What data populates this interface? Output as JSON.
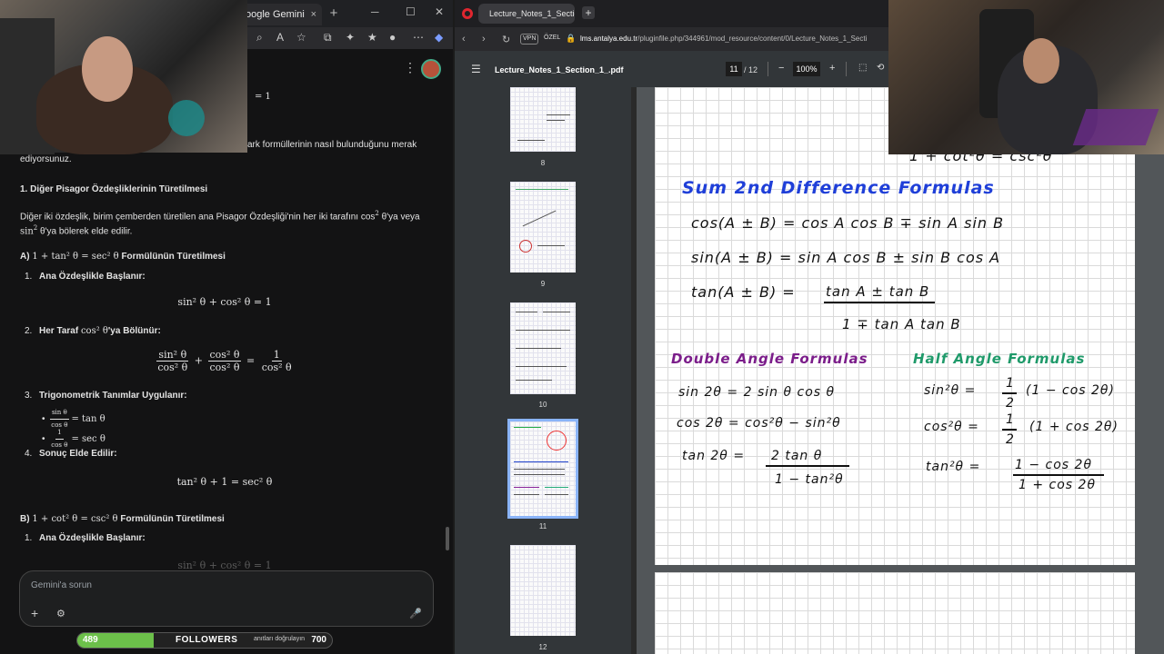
{
  "gemini": {
    "tab_title": "oogle Gemini",
    "close": "×",
    "new_tab": "+",
    "win_min": "─",
    "win_max": "☐",
    "win_close": "✕",
    "menu_icon": "⋮",
    "frag_top_math": "= 1",
    "frag_line1": "ark formüllerinin nasıl bulunduğunu merak",
    "frag_line2": "ediyorsunuz.",
    "section1_title": "1. Diğer Pisagor Özdeşliklerinin Türetilmesi",
    "intro_line1_a": "Diğer iki özdeşlik, birim çemberden türetilen ana Pisagor Özdeşliği'nin her iki tarafını cos",
    "intro_line1_b": "θ'ya veya",
    "intro_line2_a": "sin",
    "intro_line2_b": "θ'ya bölerek elde edilir.",
    "partA_prefix": "A)",
    "partA_math": "1 + tan² θ = sec² θ",
    "partA_suffix": "Formülünün Türetilmesi",
    "step1_num": "1.",
    "step1_label": "Ana Özdeşlikle Başlanır:",
    "eq1": "sin² θ + cos² θ = 1",
    "step2_num": "2.",
    "step2_label_a": "Her Taraf",
    "step2_label_math": "cos² θ",
    "step2_label_b": "'ya Bölünür:",
    "eq2_n1": "sin² θ",
    "eq2_d1": "cos² θ",
    "eq2_plus": "+",
    "eq2_n2": "cos² θ",
    "eq2_d2": "cos² θ",
    "eq2_eq": "=",
    "eq2_n3": "1",
    "eq2_d3": "cos² θ",
    "step3_num": "3.",
    "step3_label": "Trigonometrik Tanımlar Uygulanır:",
    "bullet1_n": "sin θ",
    "bullet1_d": "cos θ",
    "bullet1_r": "= tan θ",
    "bullet2_n": "1",
    "bullet2_d": "cos θ",
    "bullet2_r": "= sec θ",
    "step4_num": "4.",
    "step4_label": "Sonuç Elde Edilir:",
    "eq4": "tan² θ + 1 = sec² θ",
    "partB_prefix": "B)",
    "partB_math": "1 + cot² θ = csc² θ",
    "partB_suffix": "Formülünün Türetilmesi",
    "stepB1_num": "1.",
    "stepB1_label": "Ana Özdeşlikle Başlanır:",
    "eqB1_faded": "sin² θ + cos² θ = 1",
    "input_placeholder": "Gemini'a sorun",
    "input_plus": "+",
    "input_tools": "⚙",
    "input_mic": "🎤"
  },
  "followers_widget": {
    "current": "489",
    "label": "FOLLOWERS",
    "hidden_text": "anıtları doğrulayın",
    "goal": "700",
    "progress_fraction": 0.3,
    "fill_color": "#6cc04a"
  },
  "opera": {
    "tab_title": "Lecture_Notes_1_Section_",
    "new_tab": "+",
    "vpn": "VPN",
    "private": "ÖZEL",
    "url_host": "lms.antalya.edu.tr",
    "url_path": "/pluginfile.php/344961/mod_resource/content/0/Lecture_Notes_1_Secti",
    "nav_back": "‹",
    "nav_fwd": "›",
    "nav_reload": "↻"
  },
  "pdf": {
    "menu_icon": "☰",
    "title": "Lecture_Notes_1_Section_1_.pdf",
    "current_page": "11",
    "total": "/ 12",
    "zoom_out": "−",
    "zoom": "100%",
    "zoom_in": "+",
    "fit_icon": "⬚",
    "rotate_icon": "⟲",
    "thumbnails": [
      {
        "label": "8"
      },
      {
        "label": "9"
      },
      {
        "label": "10"
      },
      {
        "label": "11",
        "selected": true
      },
      {
        "label": "12"
      }
    ]
  },
  "notes": {
    "top_partial": "1 + cot²θ = csc²θ",
    "sum_title": "Sum 2nd Difference Formulas",
    "sum_cos": "cos(A ± B) = cos A cos B ∓ sin A sin B",
    "sum_sin": "sin(A ± B) = sin A cos B ± sin B cos A",
    "sum_tan_lhs": "tan(A ± B) =",
    "sum_tan_num": "tan A ± tan B",
    "sum_tan_den": "1 ∓ tan A tan B",
    "double_title": "Double Angle Formulas",
    "half_title": "Half Angle Formulas",
    "d_sin": "sin 2θ = 2 sin θ cos θ",
    "d_cos": "cos 2θ = cos²θ − sin²θ",
    "d_tan_lhs": "tan 2θ =",
    "d_tan_num": "2 tan θ",
    "d_tan_den": "1 − tan²θ",
    "h_sin_lhs": "sin²θ =",
    "h_sin_frac_n": "1",
    "h_sin_frac_d": "2",
    "h_sin_rhs": "(1 − cos 2θ)",
    "h_cos_lhs": "cos²θ =",
    "h_cos_frac_n": "1",
    "h_cos_frac_d": "2",
    "h_cos_rhs": "(1 + cos 2θ)",
    "h_tan_lhs": "tan²θ =",
    "h_tan_num": "1 − cos 2θ",
    "h_tan_den": "1 + cos 2θ"
  }
}
